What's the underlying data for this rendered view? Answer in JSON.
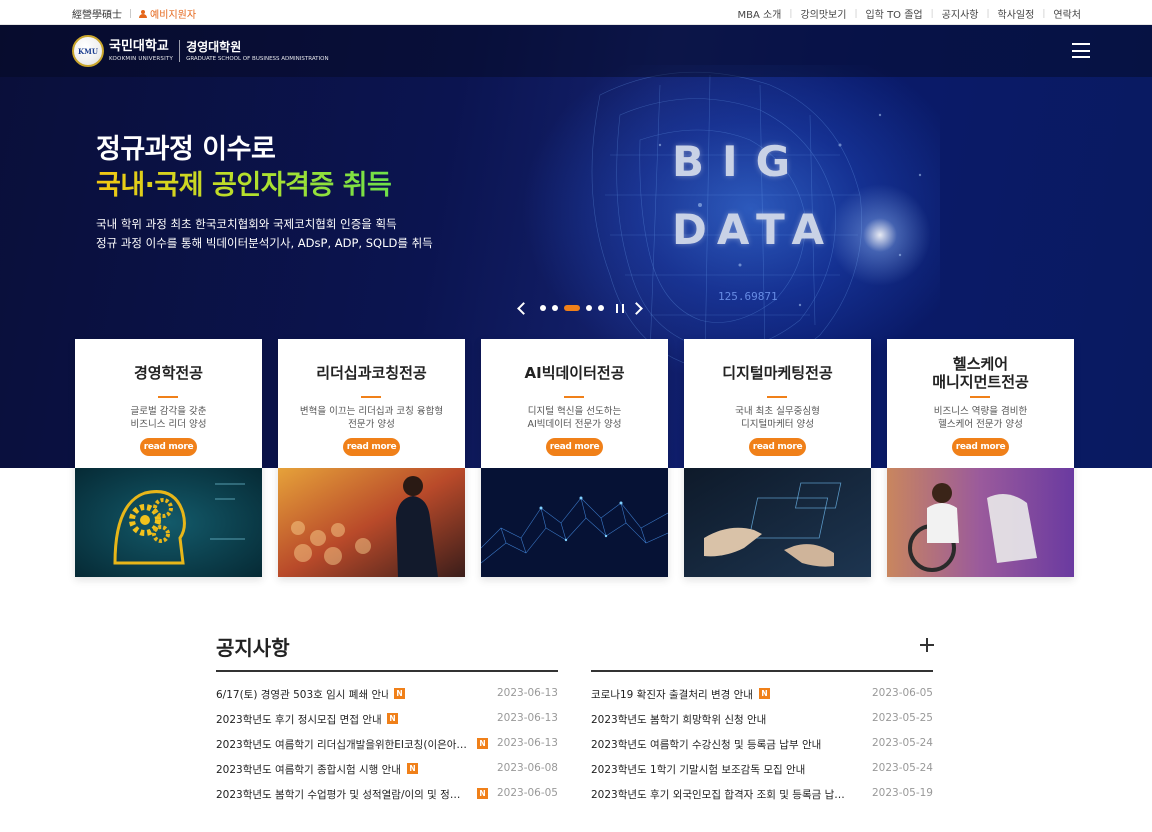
{
  "topbar": {
    "left": {
      "dept": "經營學碩士",
      "apply": "예비지원자"
    },
    "right": [
      "MBA 소개",
      "강의맛보기",
      "입학 TO 졸업",
      "공지사항",
      "학사일정",
      "연락처"
    ]
  },
  "header": {
    "logo_emblem": "KMU",
    "univ_ko": "국민대학교",
    "univ_en": "KOOKMIN UNIVERSITY",
    "school_ko": "경영대학원",
    "school_en": "GRADUATE SCHOOL OF BUSINESS ADMINISTRATION"
  },
  "hero": {
    "headline1": "정규과정 이수로",
    "headline2": "국내·국제 공인자격증 취득",
    "desc1": "국내 학위 과정 최초 한국코치협회와 국제코치협회 인증을 획득",
    "desc2": "정규 과정 이수를 통해 빅데이터분석기사, ADsP, ADP, SQLD를 취득",
    "big": "BIG",
    "data": "DATA",
    "number": "125.69871",
    "slides_total": 5,
    "slide_active": 3
  },
  "programs": [
    {
      "title1": "경영학전공",
      "title2": "",
      "sub1": "글로벌 감각을 갖춘",
      "sub2": "비즈니스 리더 양성",
      "more": "read more"
    },
    {
      "title1": "리더십과코칭전공",
      "title2": "",
      "sub1": "변혁을 이끄는 리더십과 코칭 융합형",
      "sub2": "전문가 양성",
      "more": "read more"
    },
    {
      "title1": "AI빅데이터전공",
      "title2": "",
      "sub1": "디지털 혁신을 선도하는",
      "sub2": "AI빅데이터 전문가 양성",
      "more": "read more"
    },
    {
      "title1": "디지털마케팅전공",
      "title2": "",
      "sub1": "국내 최초 실무중심형",
      "sub2": "디지털마케터 양성",
      "more": "read more"
    },
    {
      "title1": "헬스케어",
      "title2": "매니지먼트전공",
      "sub1": "비즈니스 역량을 겸비한",
      "sub2": "헬스케어 전문가 양성",
      "more": "read more"
    }
  ],
  "notices": {
    "title": "공지사항",
    "new_badge": "N",
    "left": [
      {
        "title": "6/17(토) 경영관 503호 임시 폐쇄 안내",
        "date": "2023-06-13",
        "new": true
      },
      {
        "title": "2023학년도 후기 정시모집 면접 안내",
        "date": "2023-06-13",
        "new": true
      },
      {
        "title": "2023학년도 여름학기 리더십개발을위한EI코칭(이은아…",
        "date": "2023-06-13",
        "new": true
      },
      {
        "title": "2023학년도 여름학기 종합시험 시행 안내",
        "date": "2023-06-08",
        "new": true
      },
      {
        "title": "2023학년도 봄학기 수업평가 및 성적열람/이의 및 정…",
        "date": "2023-06-05",
        "new": true
      }
    ],
    "right": [
      {
        "title": "코로나19 확진자 출결처리 변경 안내",
        "date": "2023-06-05",
        "new": true
      },
      {
        "title": "2023학년도 봄학기 희망학위 신청 안내",
        "date": "2023-05-25",
        "new": false
      },
      {
        "title": "2023학년도 여름학기 수강신청 및 등록금 납부 안내",
        "date": "2023-05-24",
        "new": false
      },
      {
        "title": "2023학년도 1학기 기말시험 보조감독 모집 안내",
        "date": "2023-05-24",
        "new": false
      },
      {
        "title": "2023학년도 후기 외국인모집 합격자 조회 및 등록금 납…",
        "date": "2023-05-19",
        "new": false
      }
    ]
  },
  "colors": {
    "accent": "#f08019",
    "hero_bg": "#0b1450"
  }
}
